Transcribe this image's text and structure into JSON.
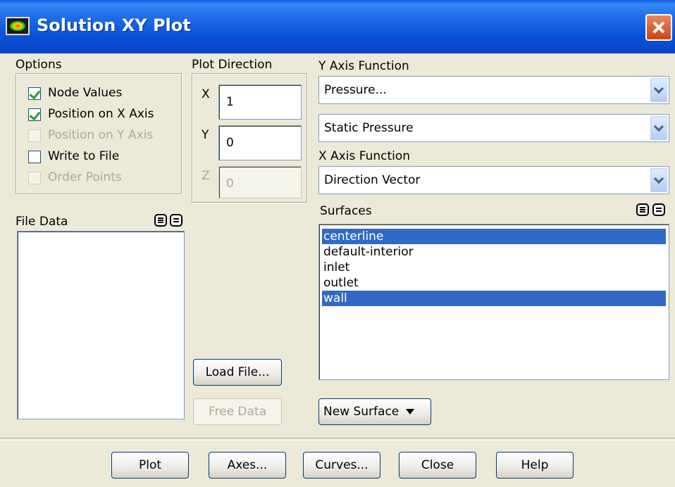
{
  "window": {
    "title": "Solution XY Plot"
  },
  "options": {
    "label": "Options",
    "items": [
      {
        "label": "Node Values",
        "checked": true,
        "enabled": true
      },
      {
        "label": "Position on X Axis",
        "checked": true,
        "enabled": true
      },
      {
        "label": "Position on Y Axis",
        "checked": false,
        "enabled": false
      },
      {
        "label": "Write to File",
        "checked": false,
        "enabled": true
      },
      {
        "label": "Order Points",
        "checked": false,
        "enabled": false
      }
    ]
  },
  "plot_direction": {
    "label": "Plot Direction",
    "x": {
      "label": "X",
      "value": "1"
    },
    "y": {
      "label": "Y",
      "value": "0"
    },
    "z": {
      "label": "Z",
      "value": "0"
    }
  },
  "y_axis": {
    "label": "Y Axis Function",
    "function": "Pressure...",
    "subfunction": "Static Pressure"
  },
  "x_axis": {
    "label": "X Axis Function",
    "function": "Direction Vector"
  },
  "file_data": {
    "label": "File Data",
    "items": []
  },
  "surfaces": {
    "label": "Surfaces",
    "items": [
      {
        "label": "centerline",
        "selected": true
      },
      {
        "label": "default-interior",
        "selected": false
      },
      {
        "label": "inlet",
        "selected": false
      },
      {
        "label": "outlet",
        "selected": false
      },
      {
        "label": "wall",
        "selected": true
      }
    ]
  },
  "buttons": {
    "load_file": "Load File...",
    "free_data": "Free Data",
    "new_surface": "New Surface",
    "plot": "Plot",
    "axes": "Axes...",
    "curves": "Curves...",
    "close": "Close",
    "help": "Help"
  }
}
